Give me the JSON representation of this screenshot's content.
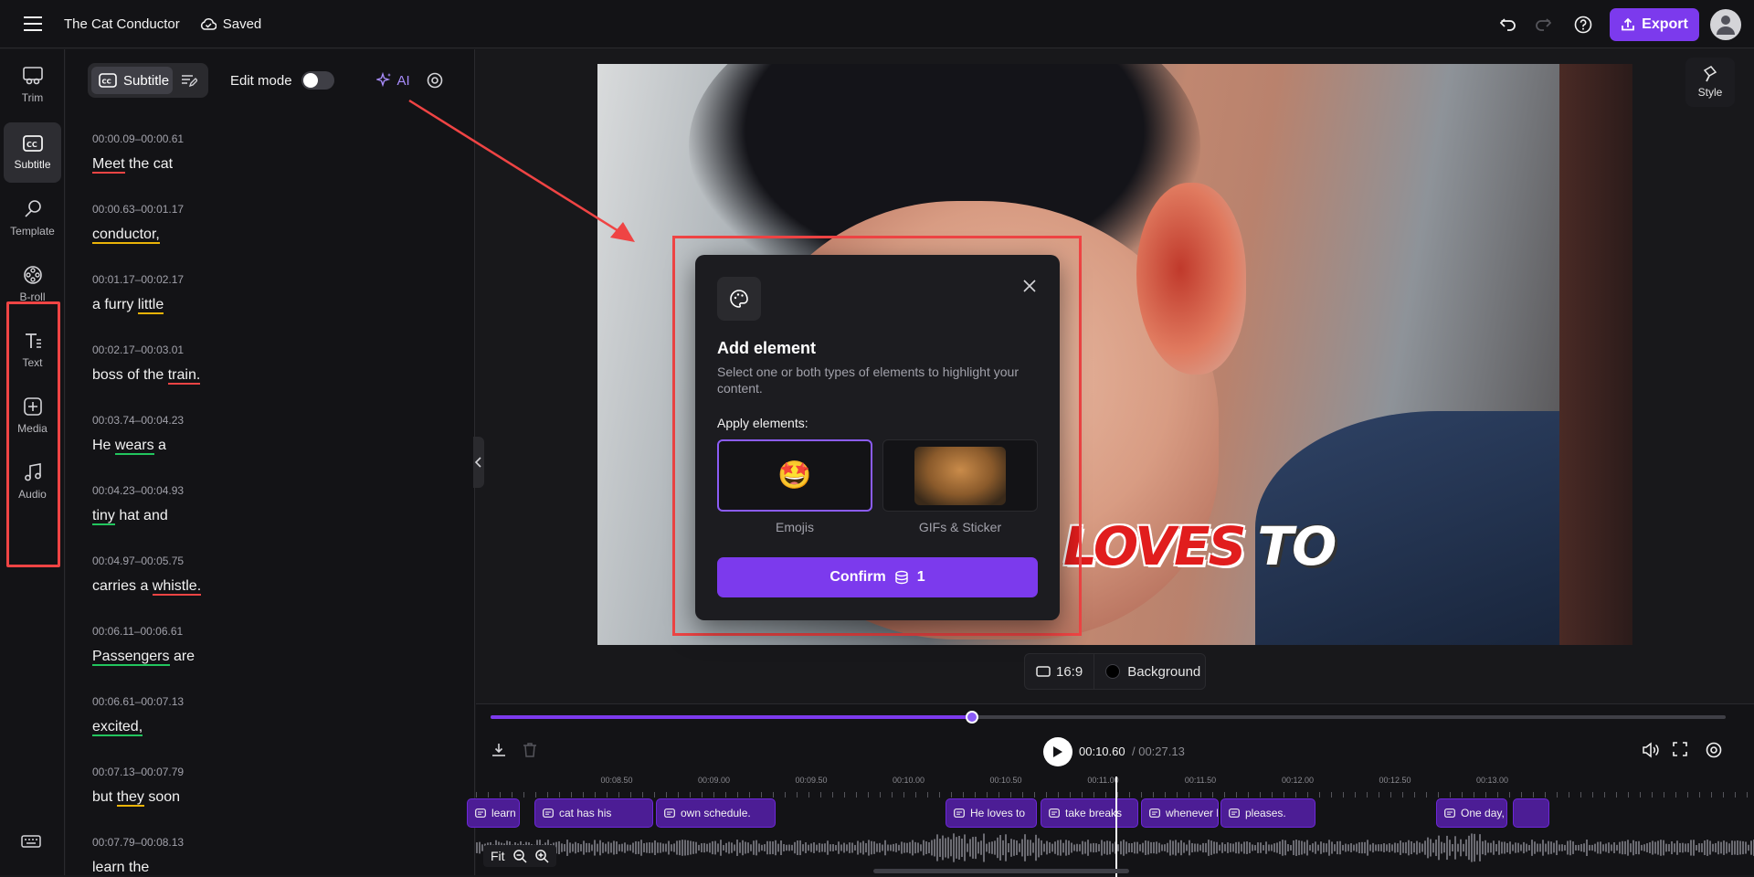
{
  "topbar": {
    "project_title": "The Cat Conductor",
    "saved_label": "Saved",
    "export_label": "Export"
  },
  "rail": {
    "items": [
      {
        "label": "Trim",
        "icon": "trim-icon"
      },
      {
        "label": "Subtitle",
        "icon": "subtitle-icon"
      },
      {
        "label": "Template",
        "icon": "template-icon"
      },
      {
        "label": "B-roll",
        "icon": "film-reel-icon"
      },
      {
        "label": "Text",
        "icon": "text-icon"
      },
      {
        "label": "Media",
        "icon": "plus-box-icon"
      },
      {
        "label": "Audio",
        "icon": "music-note-icon"
      }
    ],
    "active": "Subtitle"
  },
  "panel": {
    "subtitle_tab": "Subtitle",
    "edit_mode_label": "Edit mode",
    "ai_label": "AI",
    "subtitles": [
      {
        "time": "00:00.09–00:00.61",
        "words": [
          {
            "t": "Meet",
            "u": "red"
          },
          {
            "t": " the cat",
            "u": ""
          }
        ]
      },
      {
        "time": "00:00.63–00:01.17",
        "words": [
          {
            "t": "conductor,",
            "u": "yel"
          }
        ]
      },
      {
        "time": "00:01.17–00:02.17",
        "words": [
          {
            "t": "a furry ",
            "u": ""
          },
          {
            "t": "little",
            "u": "yel"
          }
        ]
      },
      {
        "time": "00:02.17–00:03.01",
        "words": [
          {
            "t": "boss of the ",
            "u": ""
          },
          {
            "t": "train.",
            "u": "red"
          }
        ]
      },
      {
        "time": "00:03.74–00:04.23",
        "words": [
          {
            "t": "He ",
            "u": ""
          },
          {
            "t": "wears",
            "u": "grn"
          },
          {
            "t": " a",
            "u": ""
          }
        ]
      },
      {
        "time": "00:04.23–00:04.93",
        "words": [
          {
            "t": "tiny",
            "u": "grn"
          },
          {
            "t": " hat and",
            "u": ""
          }
        ]
      },
      {
        "time": "00:04.97–00:05.75",
        "words": [
          {
            "t": "carries a ",
            "u": ""
          },
          {
            "t": "whistle.",
            "u": "red"
          }
        ]
      },
      {
        "time": "00:06.11–00:06.61",
        "words": [
          {
            "t": "Passengers",
            "u": "grn"
          },
          {
            "t": " are",
            "u": ""
          }
        ]
      },
      {
        "time": "00:06.61–00:07.13",
        "words": [
          {
            "t": "excited,",
            "u": "grn"
          }
        ]
      },
      {
        "time": "00:07.13–00:07.79",
        "words": [
          {
            "t": "but ",
            "u": ""
          },
          {
            "t": "they",
            "u": "yel"
          },
          {
            "t": " soon",
            "u": ""
          }
        ]
      },
      {
        "time": "00:07.79–00:08.13",
        "words": [
          {
            "t": "learn the",
            "u": ""
          }
        ]
      }
    ]
  },
  "preview": {
    "caption_red": "LOVES",
    "caption_white": "TO",
    "style_label": "Style",
    "aspect_label": "16:9",
    "background_label": "Background"
  },
  "dialog": {
    "title": "Add element",
    "description": "Select one or both types of elements to highlight your content.",
    "apply_label": "Apply elements:",
    "option_emojis_label": "Emojis",
    "option_emojis_glyph": "🤩",
    "option_gifs_label": "GIFs & Sticker",
    "confirm_label": "Confirm",
    "confirm_cost": "1"
  },
  "playback": {
    "progress_fraction": 0.39,
    "current_time": "00:10.60",
    "total_time": "/ 00:27.13",
    "ruler_labels": [
      "00:08.50",
      "00:09.00",
      "00:09.50",
      "00:10.00",
      "00:10.50",
      "00:11.00",
      "00:11.50",
      "00:12.00",
      "00:12.50",
      "00:13.00"
    ],
    "clips": [
      "learn the",
      "cat has his",
      "own schedule.",
      "He loves to",
      "take breaks",
      "whenever he",
      "pleases.",
      "One day,"
    ],
    "fit_label": "Fit"
  },
  "colors": {
    "accent": "#7c3aed",
    "highlight_box": "#ef4444"
  }
}
